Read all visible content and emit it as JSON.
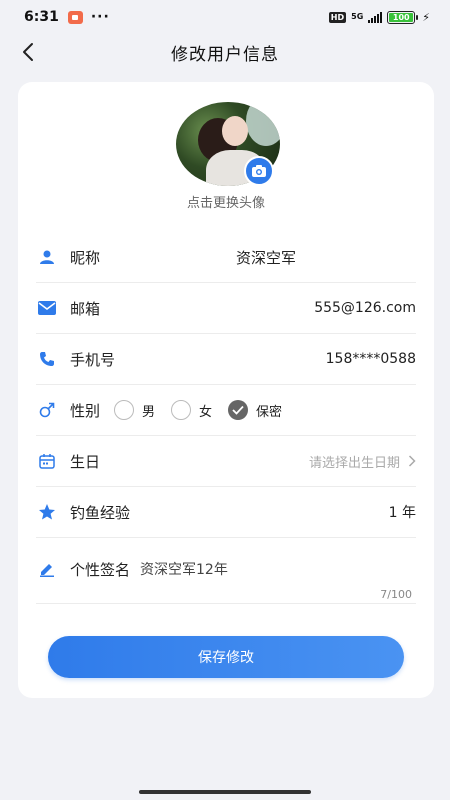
{
  "status_bar": {
    "time": "6:31",
    "more": "···",
    "hd": "HD",
    "network": "5G",
    "battery": "100"
  },
  "header": {
    "title": "修改用户信息"
  },
  "avatar": {
    "tip": "点击更换头像"
  },
  "fields": {
    "nickname": {
      "label": "昵称",
      "value": "资深空军"
    },
    "email": {
      "label": "邮箱",
      "value": "555@126.com"
    },
    "phone": {
      "label": "手机号",
      "value": "158****0588"
    },
    "gender": {
      "label": "性别",
      "options": [
        "男",
        "女",
        "保密"
      ],
      "selected": "保密"
    },
    "birthday": {
      "label": "生日",
      "placeholder": "请选择出生日期"
    },
    "experience": {
      "label": "钓鱼经验",
      "value": "1 年"
    },
    "signature": {
      "label": "个性签名",
      "value": "资深空军12年",
      "counter": "7/100"
    }
  },
  "save_label": "保存修改",
  "colors": {
    "accent": "#2f7bea",
    "background": "#f1f2f6",
    "card": "#ffffff",
    "muted": "#aaaaaa"
  }
}
